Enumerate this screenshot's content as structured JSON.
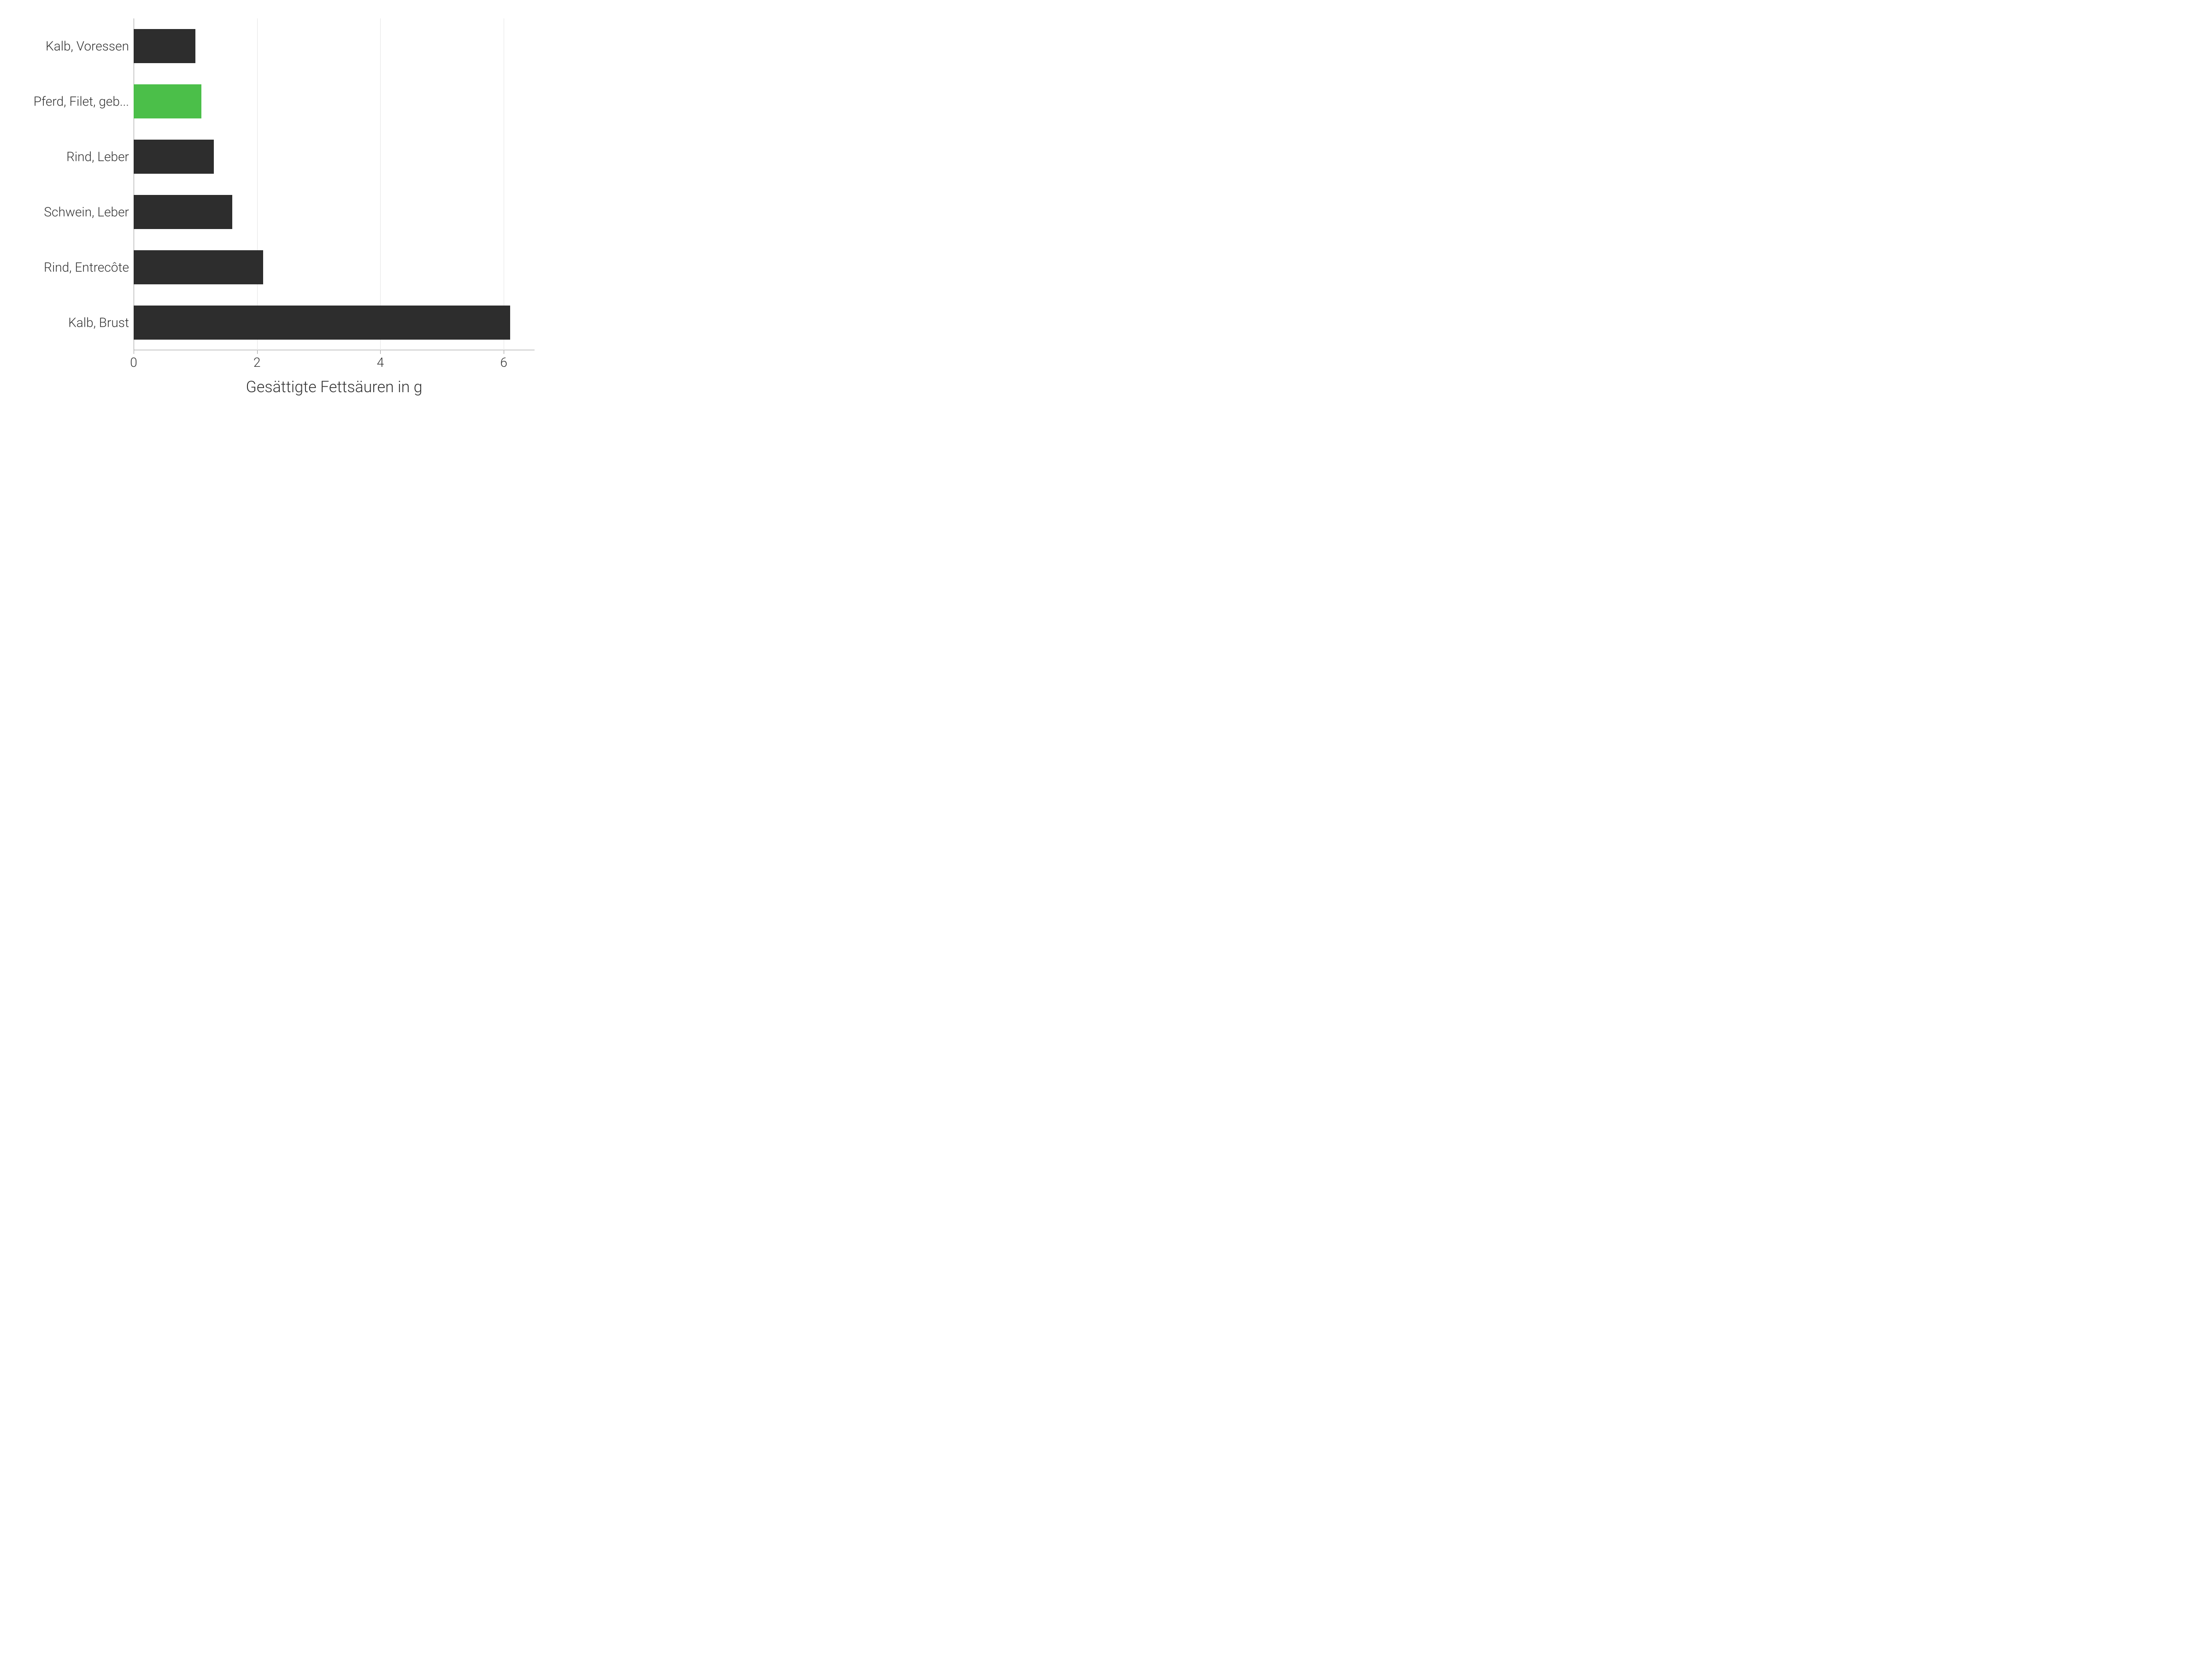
{
  "chart_data": {
    "type": "bar",
    "orientation": "horizontal",
    "categories": [
      "Kalb, Voressen",
      "Pferd, Filet, geb...",
      "Rind, Leber",
      "Schwein, Leber",
      "Rind, Entrecôte",
      "Kalb, Brust"
    ],
    "values": [
      1.0,
      1.1,
      1.3,
      1.6,
      2.1,
      6.1
    ],
    "highlight_index": 1,
    "xlabel": "Gesättigte Fettsäuren in g",
    "ylabel": "",
    "title": "",
    "xlim": [
      0,
      6.5
    ],
    "x_ticks": [
      0,
      2,
      4,
      6
    ],
    "colors": {
      "default": "#2d2d2d",
      "highlight": "#4bbf49"
    }
  }
}
